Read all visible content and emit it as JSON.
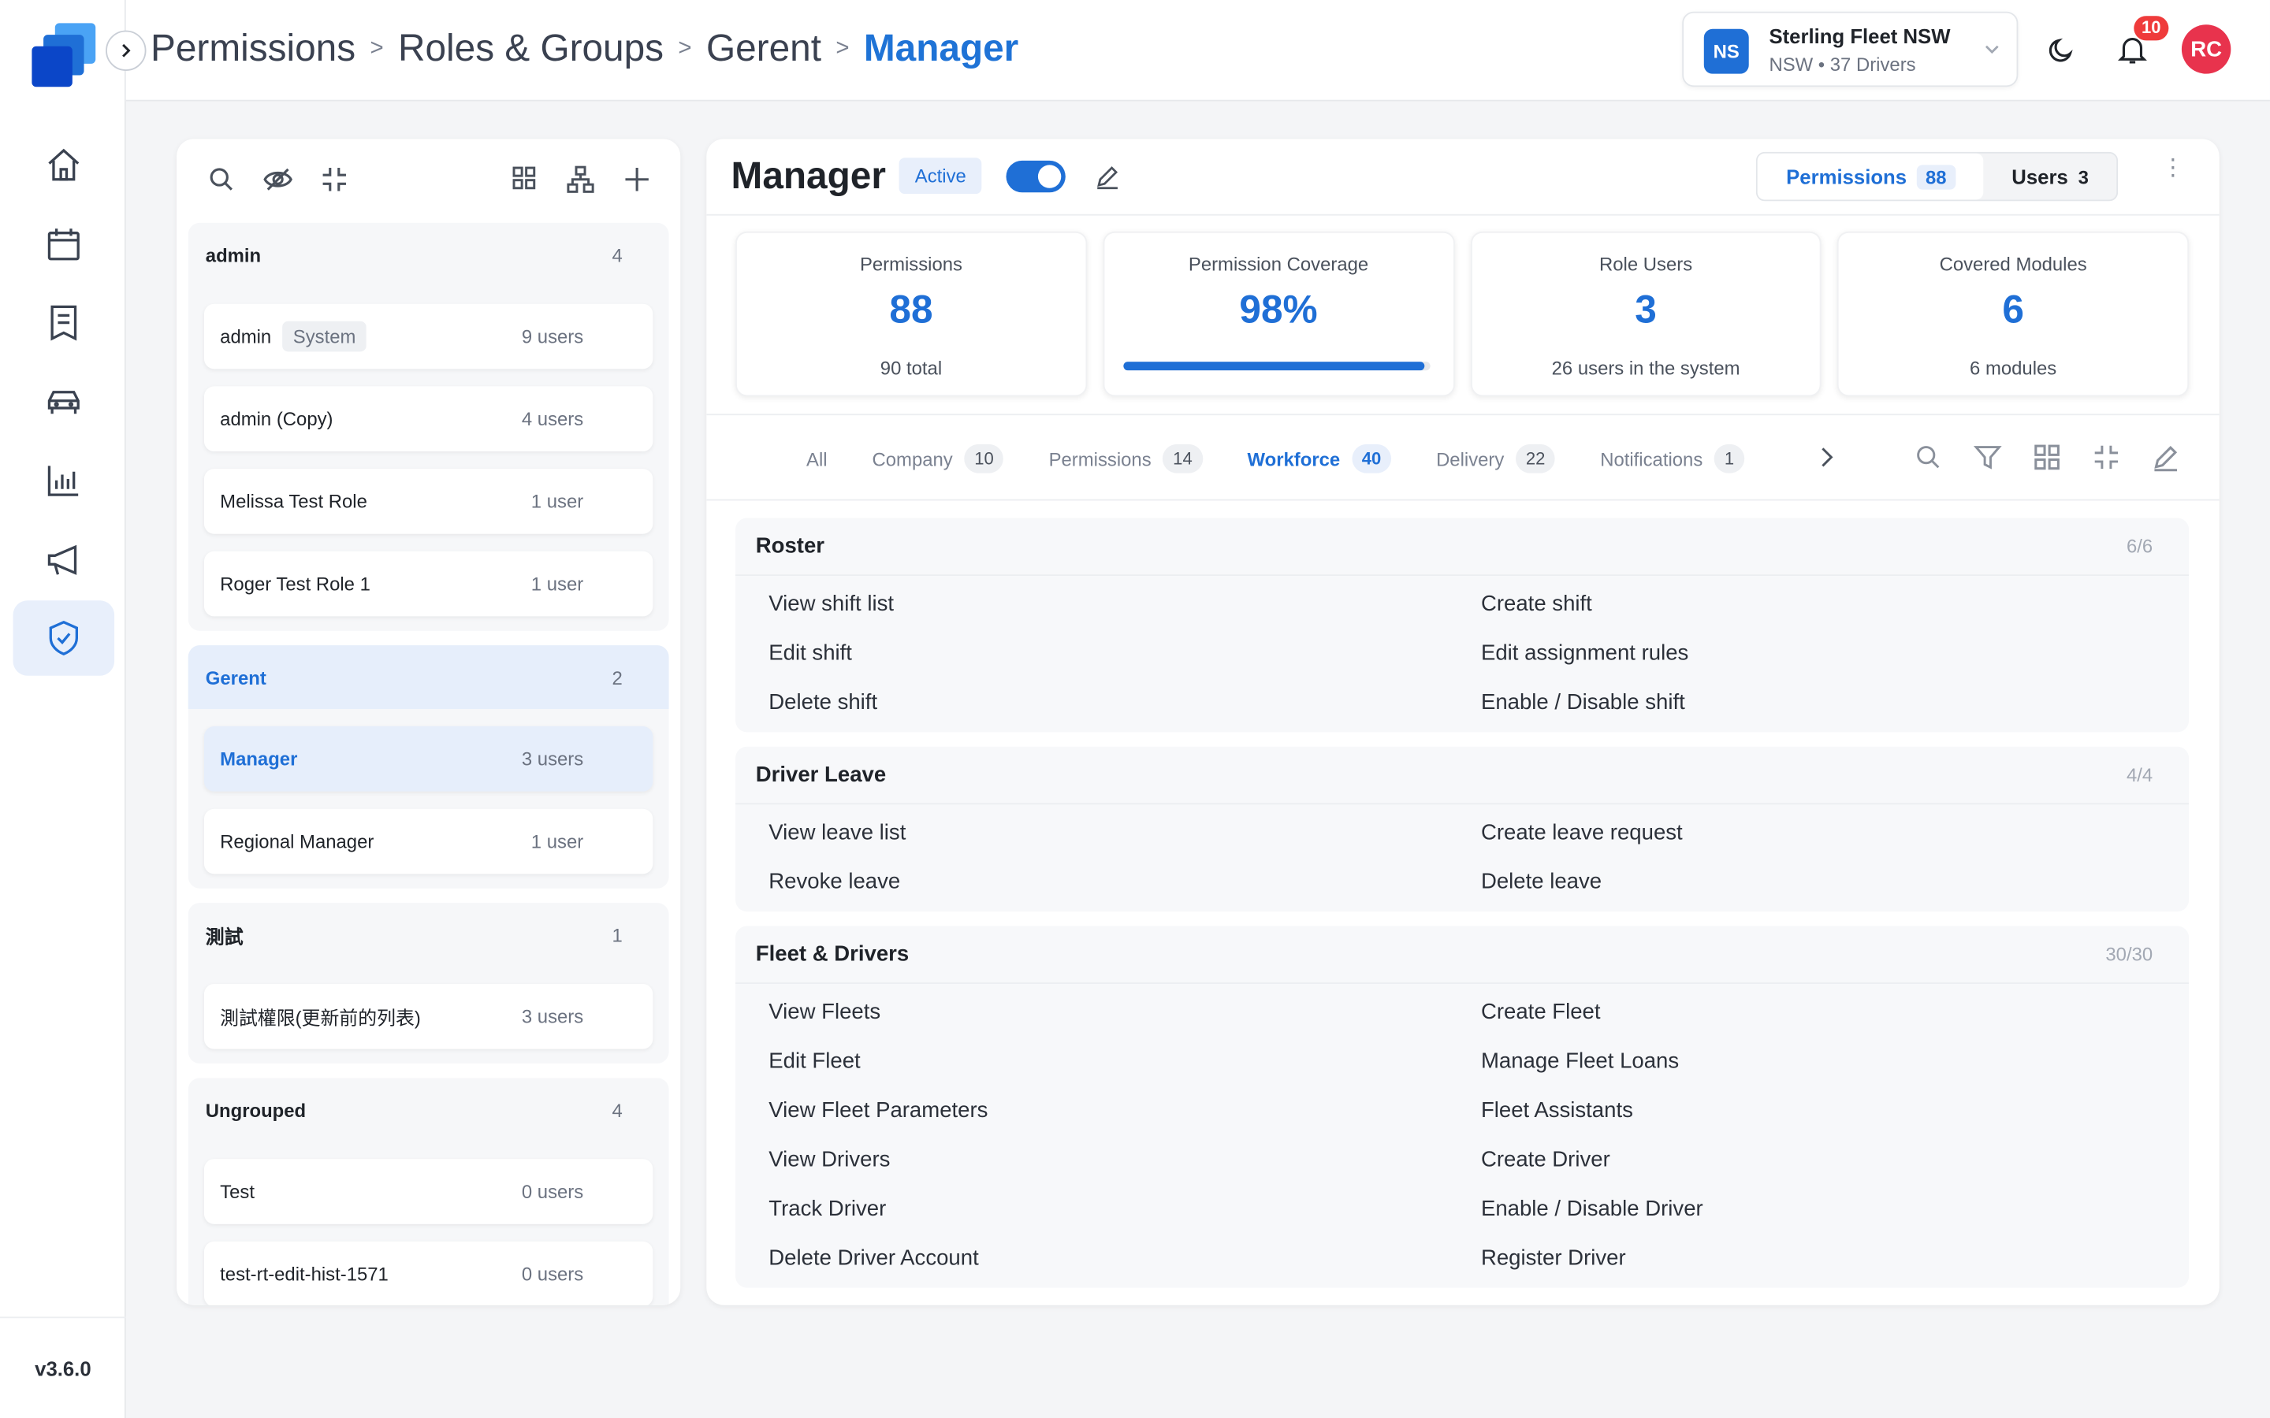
{
  "app": {
    "version": "v3.6.0"
  },
  "sidebar": {
    "items": [
      {
        "icon": "home-icon"
      },
      {
        "icon": "calendar-icon"
      },
      {
        "icon": "report-icon"
      },
      {
        "icon": "car-icon"
      },
      {
        "icon": "chart-icon"
      },
      {
        "icon": "megaphone-icon"
      },
      {
        "icon": "shield-check-icon",
        "active": true
      }
    ]
  },
  "breadcrumb": [
    "Permissions",
    "Roles & Groups",
    "Gerent",
    "Manager"
  ],
  "org": {
    "initials": "NS",
    "name": "Sterling Fleet NSW",
    "subtitle": "NSW • 37 Drivers"
  },
  "notifications": {
    "count": "10"
  },
  "user": {
    "initials": "RC"
  },
  "groups": [
    {
      "name": "admin",
      "count": "4",
      "roles": [
        {
          "name": "admin",
          "tag": "System",
          "users": "9 users"
        },
        {
          "name": "admin (Copy)",
          "users": "4 users"
        },
        {
          "name": "Melissa Test Role",
          "users": "1 user"
        },
        {
          "name": "Roger Test Role 1",
          "users": "1 user"
        }
      ]
    },
    {
      "name": "Gerent",
      "count": "2",
      "active": true,
      "roles": [
        {
          "name": "Manager",
          "users": "3 users",
          "selected": true
        },
        {
          "name": "Regional Manager",
          "users": "1 user"
        }
      ]
    },
    {
      "name": "測試",
      "count": "1",
      "roles": [
        {
          "name": "測試權限(更新前的列表)",
          "users": "3 users"
        }
      ]
    },
    {
      "name": "Ungrouped",
      "count": "4",
      "roles": [
        {
          "name": "Test",
          "users": "0 users"
        },
        {
          "name": "test-rt-edit-hist-1571",
          "users": "0 users"
        }
      ]
    }
  ],
  "role": {
    "title": "Manager",
    "status": "Active",
    "enabled": true,
    "segments": {
      "permissions_label": "Permissions",
      "permissions_count": "88",
      "users_label": "Users",
      "users_count": "3"
    }
  },
  "stats": [
    {
      "label": "Permissions",
      "value": "88",
      "sub": "90 total"
    },
    {
      "label": "Permission Coverage",
      "value": "98%",
      "progress": 0.98
    },
    {
      "label": "Role Users",
      "value": "3",
      "sub": "26 users in the system"
    },
    {
      "label": "Covered Modules",
      "value": "6",
      "sub": "6 modules"
    }
  ],
  "tabs": [
    {
      "label": "All"
    },
    {
      "label": "Company",
      "count": "10"
    },
    {
      "label": "Permissions",
      "count": "14"
    },
    {
      "label": "Workforce",
      "count": "40",
      "active": true
    },
    {
      "label": "Delivery",
      "count": "22"
    },
    {
      "label": "Notifications",
      "count": "1"
    }
  ],
  "modules": [
    {
      "title": "Roster",
      "count": "6/6",
      "perms": [
        "View shift list",
        "Create shift",
        "Edit shift",
        "Edit assignment rules",
        "Delete shift",
        "Enable / Disable shift"
      ]
    },
    {
      "title": "Driver Leave",
      "count": "4/4",
      "perms": [
        "View leave list",
        "Create leave request",
        "Revoke leave",
        "Delete leave"
      ]
    },
    {
      "title": "Fleet & Drivers",
      "count": "30/30",
      "perms": [
        "View Fleets",
        "Create Fleet",
        "Edit Fleet",
        "Manage Fleet Loans",
        "View Fleet Parameters",
        "Fleet Assistants",
        "View Drivers",
        "Create Driver",
        "Track Driver",
        "Enable / Disable Driver",
        "Delete Driver Account",
        "Register Driver"
      ]
    }
  ]
}
